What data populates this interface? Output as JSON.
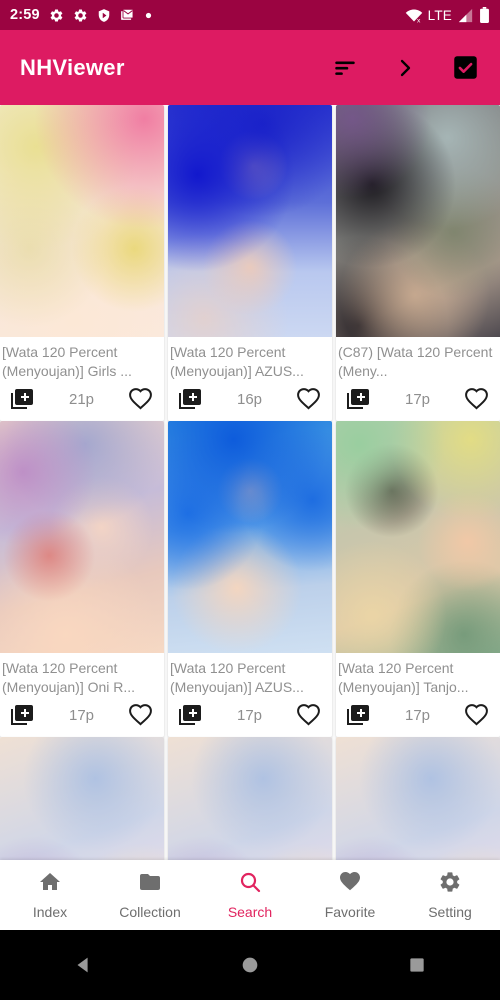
{
  "status_bar": {
    "time": "2:59",
    "left_icons": [
      "gear-icon",
      "gear-icon",
      "shield-play-icon",
      "gmail-icon",
      "dot-icon"
    ],
    "network_label": "LTE",
    "right_icons": [
      "wifi-off-icon",
      "signal-icon",
      "battery-icon"
    ],
    "background": "#9b0441"
  },
  "app_bar": {
    "title": "NHViewer",
    "background": "#dd1b62",
    "actions": [
      {
        "name": "sort-icon",
        "label": "Sort"
      },
      {
        "name": "chevron-right-icon",
        "label": "Next"
      },
      {
        "name": "checkbox-checked-icon",
        "label": "Select"
      }
    ]
  },
  "grid": {
    "rows": [
      {
        "cards": [
          {
            "title": "[Wata 120 Percent (Menyoujan)] Girls ...",
            "pages": "21p",
            "add_icon": "library-add-icon",
            "fav_icon": "heart-outline-icon"
          },
          {
            "title": "[Wata 120 Percent (Menyoujan)] AZUS...",
            "pages": "16p",
            "add_icon": "library-add-icon",
            "fav_icon": "heart-outline-icon"
          },
          {
            "title": "(C87) [Wata 120 Percent (Meny...",
            "pages": "17p",
            "add_icon": "library-add-icon",
            "fav_icon": "heart-outline-icon"
          }
        ]
      },
      {
        "cards": [
          {
            "title": "[Wata 120 Percent (Menyoujan)] Oni R...",
            "pages": "17p",
            "add_icon": "library-add-icon",
            "fav_icon": "heart-outline-icon"
          },
          {
            "title": "[Wata 120 Percent (Menyoujan)] AZUS...",
            "pages": "17p",
            "add_icon": "library-add-icon",
            "fav_icon": "heart-outline-icon"
          },
          {
            "title": "[Wata 120 Percent (Menyoujan)] Tanjo...",
            "pages": "17p",
            "add_icon": "library-add-icon",
            "fav_icon": "heart-outline-icon"
          }
        ]
      }
    ]
  },
  "bottom_nav": {
    "active_color": "#e1245f",
    "inactive_color": "#6e6e6e",
    "items": [
      {
        "label": "Index",
        "icon": "home-icon",
        "active": false
      },
      {
        "label": "Collection",
        "icon": "folder-icon",
        "active": false
      },
      {
        "label": "Search",
        "icon": "search-icon",
        "active": true
      },
      {
        "label": "Favorite",
        "icon": "heart-filled-icon",
        "active": false
      },
      {
        "label": "Setting",
        "icon": "gear-icon",
        "active": false
      }
    ]
  },
  "android_nav": {
    "buttons": [
      "back-triangle-icon",
      "home-circle-icon",
      "recents-square-icon"
    ]
  }
}
